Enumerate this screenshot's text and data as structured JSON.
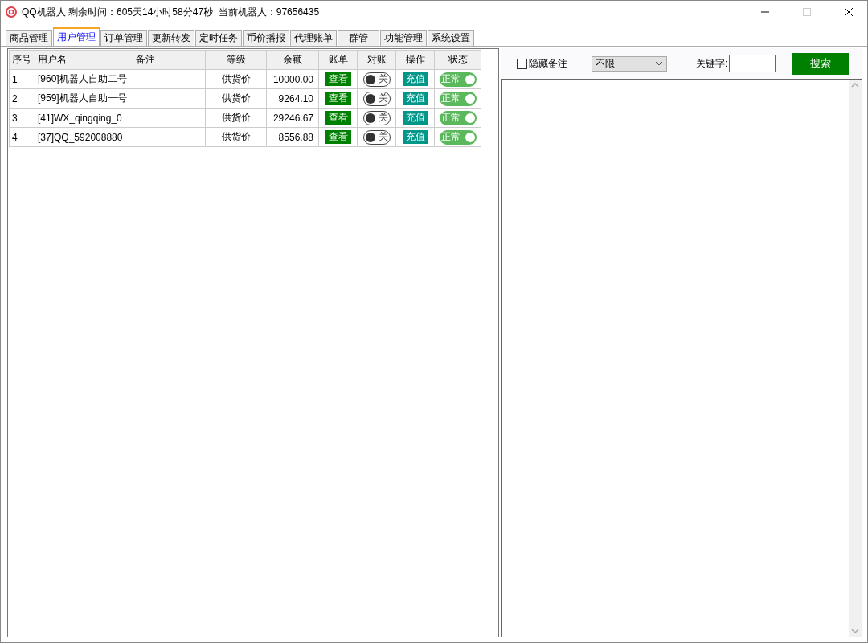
{
  "window": {
    "title": "QQ机器人 剩余时间：605天14小时58分47秒  当前机器人：97656435"
  },
  "tabs": [
    {
      "label": "商品管理",
      "selected": false
    },
    {
      "label": "用户管理",
      "selected": true
    },
    {
      "label": "订单管理",
      "selected": false
    },
    {
      "label": "更新转发",
      "selected": false
    },
    {
      "label": "定时任务",
      "selected": false
    },
    {
      "label": "币价播报",
      "selected": false
    },
    {
      "label": "代理账单",
      "selected": false
    },
    {
      "label": "群管",
      "selected": false
    },
    {
      "label": "功能管理",
      "selected": false
    },
    {
      "label": "系统设置",
      "selected": false
    }
  ],
  "table": {
    "columns": [
      "序号",
      "用户名",
      "备注",
      "等级",
      "余额",
      "账单",
      "对账",
      "操作",
      "状态"
    ],
    "rows": [
      {
        "index": "1",
        "username": "[960]机器人自助二号",
        "level": "供货价",
        "balance": "10000.00",
        "bill": "查看",
        "reconcile": {
          "label": "关",
          "on": false
        },
        "action": "充值",
        "status": {
          "label": "正常",
          "on": true
        }
      },
      {
        "index": "2",
        "username": "[959]机器人自助一号",
        "level": "供货价",
        "balance": "9264.10",
        "bill": "查看",
        "reconcile": {
          "label": "关",
          "on": false
        },
        "action": "充值",
        "status": {
          "label": "正常",
          "on": true
        }
      },
      {
        "index": "3",
        "username": "[41]WX_qingqing_0",
        "level": "供货价",
        "balance": "29246.67",
        "bill": "查看",
        "reconcile": {
          "label": "关",
          "on": false
        },
        "action": "充值",
        "status": {
          "label": "正常",
          "on": true
        }
      },
      {
        "index": "4",
        "username": "[37]QQ_592008880",
        "level": "供货价",
        "balance": "8556.88",
        "bill": "查看",
        "reconcile": {
          "label": "关",
          "on": false
        },
        "action": "充值",
        "status": {
          "label": "正常",
          "on": true
        }
      }
    ]
  },
  "filter": {
    "hide_note": {
      "label": "隐藏备注",
      "checked": false
    },
    "dropdown": {
      "value": "不限"
    },
    "keyword": {
      "label": "关键字:"
    },
    "search_button": "搜索"
  }
}
